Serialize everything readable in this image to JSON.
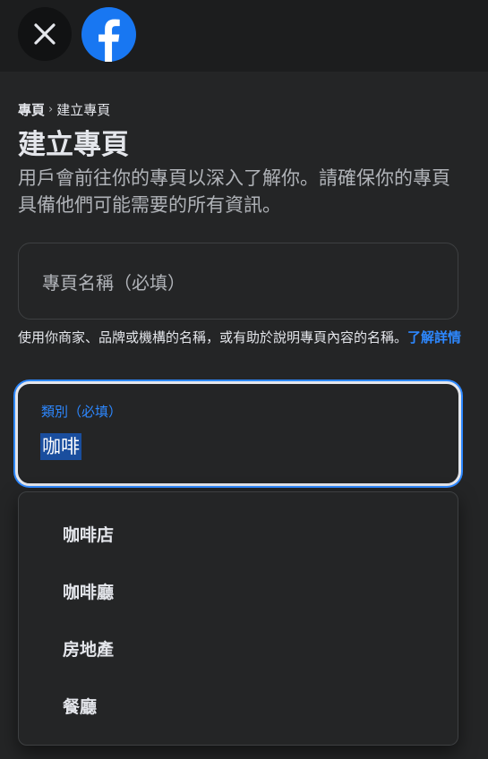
{
  "header": {
    "close_icon": "close-icon",
    "logo_icon": "facebook-logo-icon",
    "brand_color": "#1877f2"
  },
  "breadcrumb": {
    "root": "專頁",
    "separator": "›",
    "current": "建立專頁"
  },
  "page": {
    "title": "建立專頁",
    "description": "用戶會前往你的專頁以深入了解你。請確保你的專頁具備他們可能需要的所有資訊。"
  },
  "name_field": {
    "placeholder": "專頁名稱（必填）",
    "value": ""
  },
  "helper": {
    "text": "使用你商家、品牌或機構的名稱，或有助於說明專頁內容的名稱。",
    "link": "了解詳情"
  },
  "category_field": {
    "label": "類別（必填）",
    "value": "咖啡"
  },
  "dropdown": {
    "options": [
      "咖啡店",
      "咖啡廳",
      "房地產",
      "餐廳"
    ]
  },
  "colors": {
    "accent": "#2d88ff",
    "background": "#242526",
    "topbar": "#1c1d1e"
  }
}
